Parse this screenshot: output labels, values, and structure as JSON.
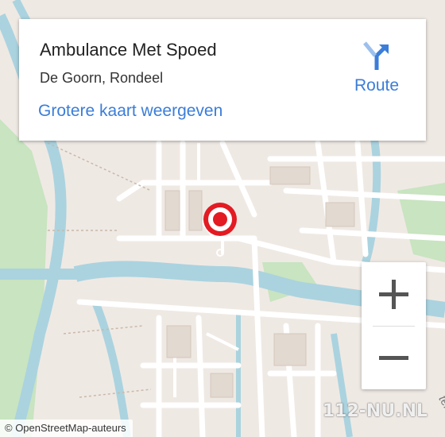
{
  "place": {
    "title": "Ambulance Met Spoed",
    "subtitle": "De Goorn, Rondeel",
    "larger_map_link": "Grotere kaart weergeven"
  },
  "route": {
    "label": "Route",
    "icon": "directions-turn-icon"
  },
  "zoom": {
    "in_symbol": "+",
    "out_symbol": "−"
  },
  "attribution": "© OpenStreetMap-auteurs",
  "watermark": "112-NU.NL",
  "street_fragment": "terra",
  "colors": {
    "water": "#aad3df",
    "park": "#c8e4c0",
    "land": "#efe9e4",
    "road": "#ffffff",
    "marker_red": "#e31b23",
    "link_blue": "#3b7dd8"
  }
}
